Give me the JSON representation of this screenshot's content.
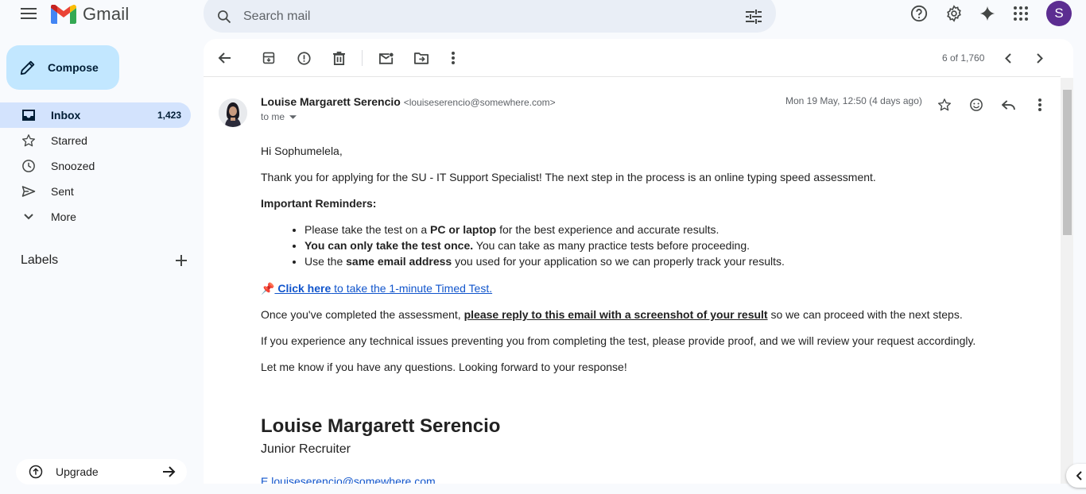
{
  "app": {
    "logo_text": "Gmail"
  },
  "search": {
    "placeholder": "Search mail"
  },
  "account": {
    "initial": "S"
  },
  "compose": {
    "label": "Compose"
  },
  "nav": [
    {
      "label": "Inbox",
      "count": "1,423"
    },
    {
      "label": "Starred"
    },
    {
      "label": "Snoozed"
    },
    {
      "label": "Sent"
    },
    {
      "label": "More"
    }
  ],
  "labels": {
    "title": "Labels"
  },
  "upgrade": {
    "label": "Upgrade"
  },
  "pager": {
    "text": "6 of 1,760"
  },
  "message": {
    "sender_name": "Louise Margarett Serencio",
    "sender_email": "<louiseserencio@somewhere.com>",
    "to": "to me",
    "date": "Mon 19 May, 12:50 (4 days ago)",
    "greeting": "Hi Sophumelela,",
    "intro": "Thank you for applying for the SU - IT Support Specialist! The next step in the process is an online typing speed assessment.",
    "reminders_heading": "Important Reminders:",
    "r1_a": "Please take the test on a ",
    "r1_b": "PC or laptop",
    "r1_c": " for the best experience and accurate results.",
    "r2_a": "You can only take the test once.",
    "r2_b": " You can take as many practice tests before proceeding.",
    "r3_a": "Use the ",
    "r3_b": "same email address",
    "r3_c": " you used for your application so we can properly track your results.",
    "pin": "📌",
    "link_bold": " Click here",
    "link_rest": " to take the 1-minute Timed Test.",
    "after_a": "Once you've completed the assessment, ",
    "after_b": "please reply to this email with a screenshot of your result",
    "after_c": " so we can proceed with the next steps.",
    "issues": "If you experience any technical issues preventing you from completing the test, please provide proof, and we will review your request accordingly.",
    "closing": "Let me know if you have any questions. Looking forward to your response!",
    "sig_name": "Louise Margarett Serencio",
    "sig_title": "Junior Recruiter",
    "sig_email": "E  louiseserencio@somewhere.com"
  },
  "colors": {
    "compose_bg": "#c2e7ff",
    "nav_active": "#d3e3fd",
    "link": "#1155cc",
    "avatar": "#5c2d91"
  }
}
